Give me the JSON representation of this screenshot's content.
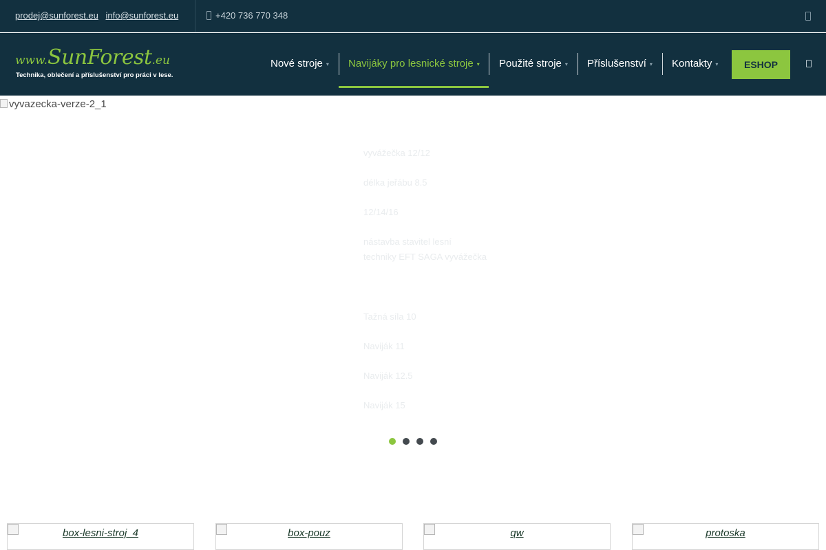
{
  "topbar": {
    "emails": [
      "prodej@sunforest.eu",
      "info@sunforest.eu"
    ],
    "phone": "+420 736 770 348",
    "phone_icon": "phone-icon",
    "right_icon": "mobile-icon"
  },
  "header": {
    "logo": {
      "prefix": "www.",
      "name": "SunForest",
      "suffix": ".eu",
      "tagline": "Technika, oblečení a příslušenství pro práci v lese."
    },
    "nav": [
      {
        "label": "Nové stroje",
        "caret": "▾"
      },
      {
        "label": "Navijáky pro lesnické stroje",
        "caret": "▾",
        "active": true
      },
      {
        "label": "Použité stroje",
        "caret": "▾"
      },
      {
        "label": "Příslušenství",
        "caret": "▾"
      },
      {
        "label": "Kontakty",
        "caret": "▾"
      }
    ],
    "eshop_label": "ESHOP",
    "search_icon": "search-icon"
  },
  "hero": {
    "image_alt": "vyvazecka-verze-2_1",
    "faint_lines": [
      "vyvážečka 12/12",
      "délka jeřábu 8.5",
      "12/14/16",
      "nástavba stavitel lesní",
      "techniky EFT SAGA vyvážečka",
      "Tažná síla 10",
      "Naviják 11",
      "Naviják 12.5",
      "Naviják 15"
    ],
    "slider_dots": 4,
    "active_dot": 0
  },
  "boxes": [
    {
      "alt": "box-lesni-stroj_4"
    },
    {
      "alt": "box-pouz"
    },
    {
      "alt": "qw"
    },
    {
      "alt": "protoska"
    }
  ],
  "colors": {
    "header_bg": "#12303f",
    "accent": "#8cc63f"
  }
}
